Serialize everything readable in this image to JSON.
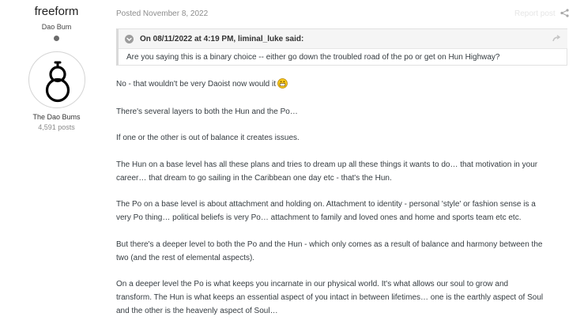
{
  "author": {
    "username": "freeform",
    "title": "Dao Bum",
    "group": "The Dao Bums",
    "post_count": "4,591 posts"
  },
  "post": {
    "posted": "Posted November 8, 2022",
    "report_label": "Report post",
    "quote": {
      "citation": "On 08/11/2022 at 4:19 PM, liminal_luke said:",
      "text": "Are you saying this is a binary choice -- either go down the troubled road of the po or get on Hun Highway?"
    },
    "paragraphs": [
      {
        "lines": [
          "No - that wouldn't be very Daoist now would it"
        ]
      },
      {
        "lines": [
          "There's several layers to both the Hun and the Po…"
        ]
      },
      {
        "lines": [
          "If one or the other is out of balance it creates issues."
        ]
      },
      {
        "lines": [
          "The Hun on a base level has all these plans and tries to dream up all these things it wants to do… that motivation in your",
          "career… that dream to go sailing in the Caribbean one day etc - that's the Hun."
        ]
      },
      {
        "lines": [
          "The Po on a base level is about attachment and holding on. Attachment to identity - personal 'style' or fashion sense is a",
          "very Po thing… political beliefs is very Po… attachment to family and loved ones and home and sports team etc etc."
        ]
      },
      {
        "lines": [
          "But there's a deeper level to both the Po and the Hun - which only comes as a result of balance and harmony between the",
          "two (and the rest of elemental aspects)."
        ]
      },
      {
        "lines": [
          "On a deeper level the Po is what keeps you incarnate in our physical world. It's what allows our soul to grow and",
          "transform. The Hun is what keeps an essential aspect of you intact in between lifetimes… one is the earthly aspect of Soul",
          "and the other is the heavenly aspect of Soul…"
        ]
      }
    ]
  },
  "icons": {
    "share": "share-icon",
    "quote_toggle": "chevron-down-icon",
    "quote_link": "link-arrow-icon",
    "emoji": "grin-emoji-icon",
    "avatar": "gourd-icon",
    "online": "status-dot-icon"
  },
  "colors": {
    "text": "#353c41",
    "muted": "#8c8c8c",
    "quote_header_bg": "#f5f5f5",
    "emoji": "#f5c518"
  }
}
